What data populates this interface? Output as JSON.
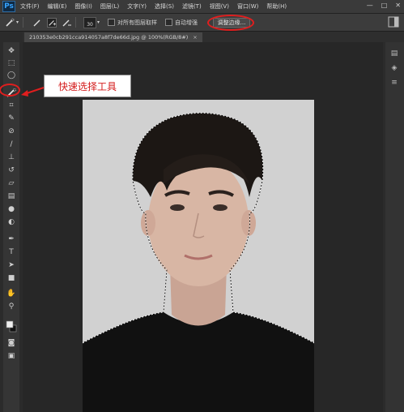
{
  "app": {
    "logo": "Ps"
  },
  "menu": [
    "文件(F)",
    "编辑(E)",
    "图像(I)",
    "图层(L)",
    "文字(Y)",
    "选择(S)",
    "滤镜(T)",
    "视图(V)",
    "窗口(W)",
    "帮助(H)"
  ],
  "window_controls": {
    "minimize": "—",
    "restore": "□",
    "close": "✕"
  },
  "options": {
    "brush_size": "30",
    "sample_all_layers": "对所有图层取样",
    "auto_enhance": "自动增强",
    "refine_edge": "调整边缘..."
  },
  "document_tab": {
    "title": "210353e0cb291cca914057a8f7de66d.jpg @ 100%(RGB/8#)",
    "close": "×"
  },
  "annotation": {
    "label": "快速选择工具",
    "color": "#e01e1e"
  },
  "tools": [
    "move-icon",
    "marquee-icon",
    "lasso-icon",
    "quick-selection-icon",
    "crop-icon",
    "eyedropper-icon",
    "healing-icon",
    "brush-icon",
    "clone-stamp-icon",
    "history-brush-icon",
    "eraser-icon",
    "gradient-icon",
    "blur-icon",
    "dodge-icon",
    "pen-icon",
    "type-icon",
    "path-selection-icon",
    "rectangle-icon",
    "hand-icon",
    "zoom-icon",
    "color-swatches-icon",
    "quick-mask-icon",
    "screen-mode-icon"
  ],
  "colors": {
    "accent": "#e01e1e",
    "ps_blue": "#36a3ff",
    "photo_background": "#d1d1d1",
    "shirt": "#111111",
    "hair": "#1c1714",
    "skin": "#d8b6a4"
  }
}
